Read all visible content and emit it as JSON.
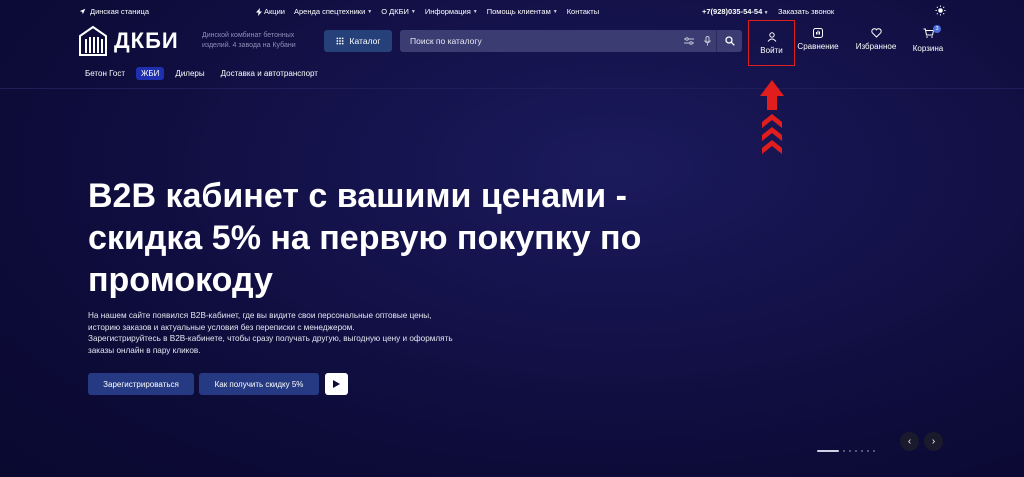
{
  "topbar": {
    "city": "Динская станица",
    "links": [
      {
        "label": "Акции",
        "dropdown": false,
        "icon": "lightning-icon"
      },
      {
        "label": "Аренда спецтехники",
        "dropdown": true
      },
      {
        "label": "О ДКБИ",
        "dropdown": true
      },
      {
        "label": "Информация",
        "dropdown": true
      },
      {
        "label": "Помощь клиентам",
        "dropdown": true
      },
      {
        "label": "Контакты",
        "dropdown": false
      }
    ],
    "phone": "+7(928)035-54-54",
    "callback": "Заказать звонок"
  },
  "header": {
    "logo_text": "ДКБИ",
    "tagline": "Динской комбинат бетонных изделий. 4 завода на Кубани",
    "catalog_label": "Каталог",
    "search_placeholder": "Поиск по каталогу",
    "login_label": "Войти",
    "compare_label": "Сравнение",
    "favorites_label": "Избранное",
    "cart_label": "Корзина",
    "cart_count": "3"
  },
  "subnav": [
    "Бетон Гост",
    "ЖБИ",
    "Дилеры",
    "Доставка и автотранспорт"
  ],
  "hero": {
    "title": "B2B кабинет с вашими ценами - скидка 5% на первую покупку по промокоду",
    "text_1": "На нашем сайте появился B2B-кабинет, где вы видите свои персональные оптовые цены, историю заказов и актуальные условия без переписки с менеджером.",
    "text_2": "Зарегистрируйтесь в B2B-кабинете, чтобы сразу получать другую, выгодную цену и оформлять заказы онлайн в пару кликов.",
    "register_label": "Зарегистрироваться",
    "promo_label": "Как получить скидку 5%"
  },
  "colors": {
    "background": "#0d0b38",
    "button": "#253a82",
    "highlight": "#e11d1d",
    "active_pill": "#1e2fb0"
  }
}
